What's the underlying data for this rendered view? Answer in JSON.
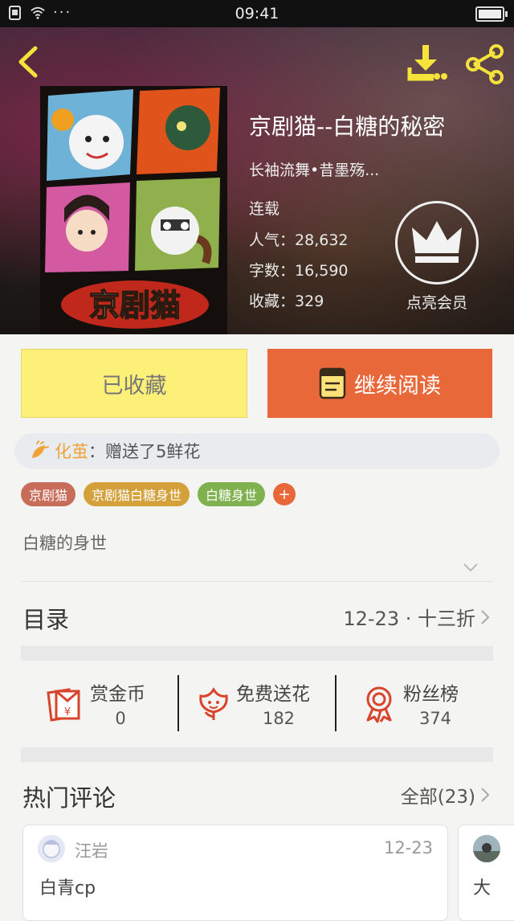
{
  "status": {
    "time": "09:41",
    "dots": "···"
  },
  "book": {
    "title": "京剧猫--白糖的秘密",
    "author": "长袖流舞•昔墨殇...",
    "serial_status": "连载",
    "popularity_label": "人气：",
    "popularity": "28,632",
    "words_label": "字数：",
    "words": "16,590",
    "favorites_label": "收藏：",
    "favorites": "329",
    "cover_logo_text": "京剧猫"
  },
  "vip": {
    "label": "点亮会员"
  },
  "actions": {
    "favorited": "已收藏",
    "continue_reading": "继续阅读"
  },
  "gift": {
    "user": "化茧",
    "message": "：赠送了5鲜花"
  },
  "tags": [
    {
      "label": "京剧猫",
      "color": "#c86d5a"
    },
    {
      "label": "京剧猫白糖身世",
      "color": "#d4a03a"
    },
    {
      "label": "白糖身世",
      "color": "#7fb24e"
    }
  ],
  "tag_add": "+",
  "description": "白糖的身世",
  "toc": {
    "label": "目录",
    "info": "12-23 · 十三折"
  },
  "rewards": [
    {
      "label": "赏金币",
      "value": "0",
      "icon": "red-envelope-icon"
    },
    {
      "label": "免费送花",
      "value": "182",
      "icon": "flower-icon"
    },
    {
      "label": "粉丝榜",
      "value": "374",
      "icon": "medal-icon"
    }
  ],
  "comments": {
    "label": "热门评论",
    "all": "全部(23)",
    "items": [
      {
        "user": "汪岩",
        "date": "12-23",
        "text": "白青cp"
      },
      {
        "user": "",
        "date": "",
        "text": "大"
      }
    ]
  },
  "colors": {
    "accent": "#e8683a",
    "fav_yellow": "#fdf078",
    "icon_red": "#d8442c"
  }
}
